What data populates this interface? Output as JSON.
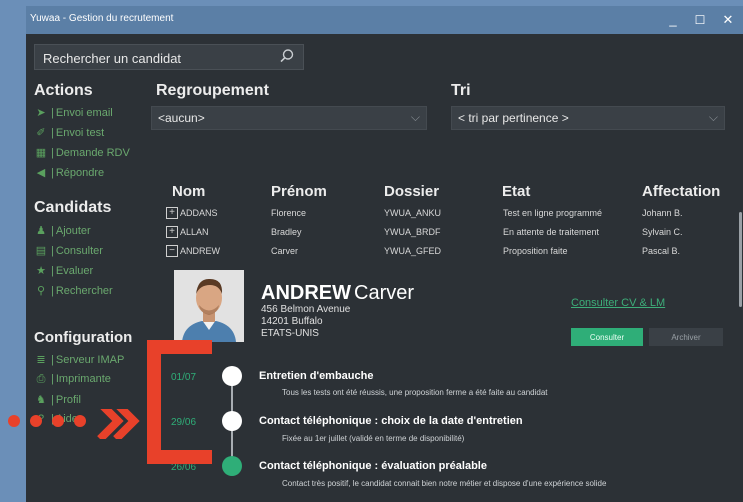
{
  "window": {
    "title": "Yuwaa - Gestion du recrutement",
    "minimize": "_",
    "maximize": "☐",
    "close": "✕"
  },
  "search": {
    "placeholder": "Rechercher un candidat"
  },
  "sidebar": {
    "actions_title": "Actions",
    "actions": [
      {
        "label": "Envoi email",
        "icon": "send-icon"
      },
      {
        "label": "Envoi test",
        "icon": "send-test-icon"
      },
      {
        "label": "Demande RDV",
        "icon": "calendar-icon"
      },
      {
        "label": "Répondre",
        "icon": "reply-icon"
      }
    ],
    "candidats_title": "Candidats",
    "candidats": [
      {
        "label": "Ajouter",
        "icon": "add-user-icon"
      },
      {
        "label": "Consulter",
        "icon": "id-card-icon"
      },
      {
        "label": "Evaluer",
        "icon": "star-icon"
      },
      {
        "label": "Rechercher",
        "icon": "search-icon"
      }
    ],
    "config_title": "Configuration",
    "config": [
      {
        "label": "Serveur IMAP",
        "icon": "server-icon"
      },
      {
        "label": "Imprimante",
        "icon": "printer-icon"
      },
      {
        "label": "Profil",
        "icon": "profile-icon"
      },
      {
        "label": "Aide",
        "icon": "help-icon"
      }
    ]
  },
  "grouping": {
    "label": "Regroupement",
    "value": "<aucun>"
  },
  "sort": {
    "label": "Tri",
    "value": "< tri par pertinence >"
  },
  "table": {
    "headers": [
      "Nom",
      "Prénom",
      "Dossier",
      "Etat",
      "Affectation"
    ],
    "rows": [
      {
        "toggle": "+",
        "nom": "ADDANS",
        "prenom": "Florence",
        "dossier": "YWUA_ANKU",
        "etat": "Test en ligne programmé",
        "affectation": "Johann B."
      },
      {
        "toggle": "+",
        "nom": "ALLAN",
        "prenom": "Bradley",
        "dossier": "YWUA_BRDF",
        "etat": "En attente de traitement",
        "affectation": "Sylvain C."
      },
      {
        "toggle": "−",
        "nom": "ANDREW",
        "prenom": "Carver",
        "dossier": "YWUA_GFED",
        "etat": "Proposition faite",
        "affectation": "Pascal B."
      }
    ]
  },
  "detail": {
    "last_name": "ANDREW",
    "first_name": "Carver",
    "address_line1": "456 Belmon Avenue",
    "address_line2": "14201 Buffalo",
    "address_line3": "ETATS-UNIS",
    "cv_link": "Consulter CV & LM",
    "consult_button": "Consulter",
    "archive_button": "Archiver"
  },
  "timeline": [
    {
      "date": "01/07",
      "title": "Entretien d'embauche",
      "desc": "Tous les tests ont été réussis, une proposition ferme a été faite au candidat",
      "dot_color": "#ffffff"
    },
    {
      "date": "29/06",
      "title": "Contact téléphonique : choix de la date d'entretien",
      "desc": "Fixée au 1er juillet (validé en terme de disponibilité)",
      "dot_color": "#ffffff"
    },
    {
      "date": "26/06",
      "title": "Contact téléphonique : évaluation préalable",
      "desc": "Contact très positif, le candidat connait bien notre métier et dispose d'une expérience solide",
      "dot_color": "#2fae78"
    }
  ],
  "colors": {
    "accent": "#2fae78",
    "titlebar": "#5b7fa6",
    "background": "#2c3136",
    "annotation": "#e8412a"
  }
}
